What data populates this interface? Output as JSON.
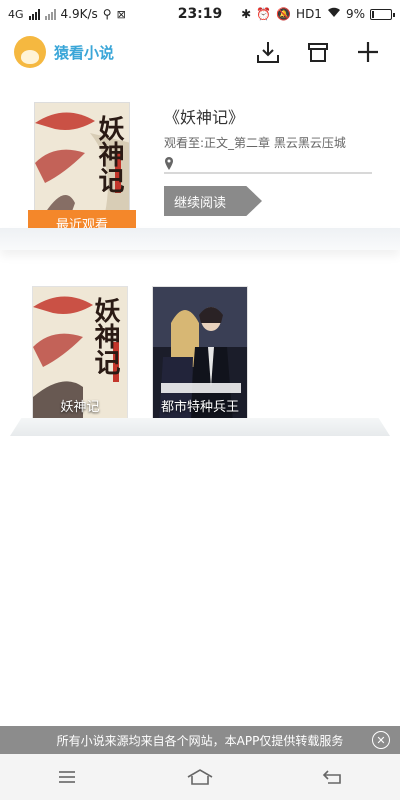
{
  "status_bar": {
    "network": "4G",
    "speed": "4.9K/s",
    "time": "23:19",
    "hd_label": "HD1",
    "battery_text": "9%",
    "battery_level": 0.09
  },
  "header": {
    "app_name": "猿看小说",
    "logo_icon": "monkey-logo-icon",
    "actions": [
      {
        "icon": "download-icon"
      },
      {
        "icon": "bookshelf-icon"
      },
      {
        "icon": "plus-icon"
      }
    ]
  },
  "recent": {
    "title": "《妖神记》",
    "progress": "观看至:正文_第二章 黑云黑云压城",
    "badge": "最近观看",
    "continue_label": "继续阅读",
    "cover_text": "妖神记"
  },
  "shelf": {
    "books": [
      {
        "title": "妖神记",
        "cover_text": "妖神记"
      },
      {
        "title": "都市特种兵王",
        "cover_text": ""
      }
    ]
  },
  "notice": {
    "text": "所有小说来源均来自各个网站，本APP仅提供转载服务",
    "close_icon": "close-circle-icon"
  },
  "nav": {
    "items": [
      "menu-icon",
      "home-icon",
      "back-icon"
    ]
  },
  "colors": {
    "accent": "#3aa6d8",
    "badge": "#f4872a",
    "button_gray": "#8a8a8a"
  }
}
